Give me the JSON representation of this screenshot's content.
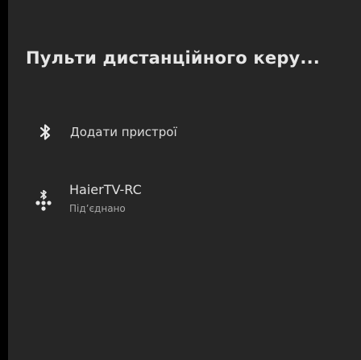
{
  "panel": {
    "title": "Пульти дистанційного керу...",
    "add_device": {
      "label": "Додати пристрої",
      "icon": "bluetooth-icon"
    },
    "devices": [
      {
        "name": "HaierTV-RC",
        "status": "Підʼєднано",
        "icon": "remote-control-icon"
      }
    ]
  }
}
